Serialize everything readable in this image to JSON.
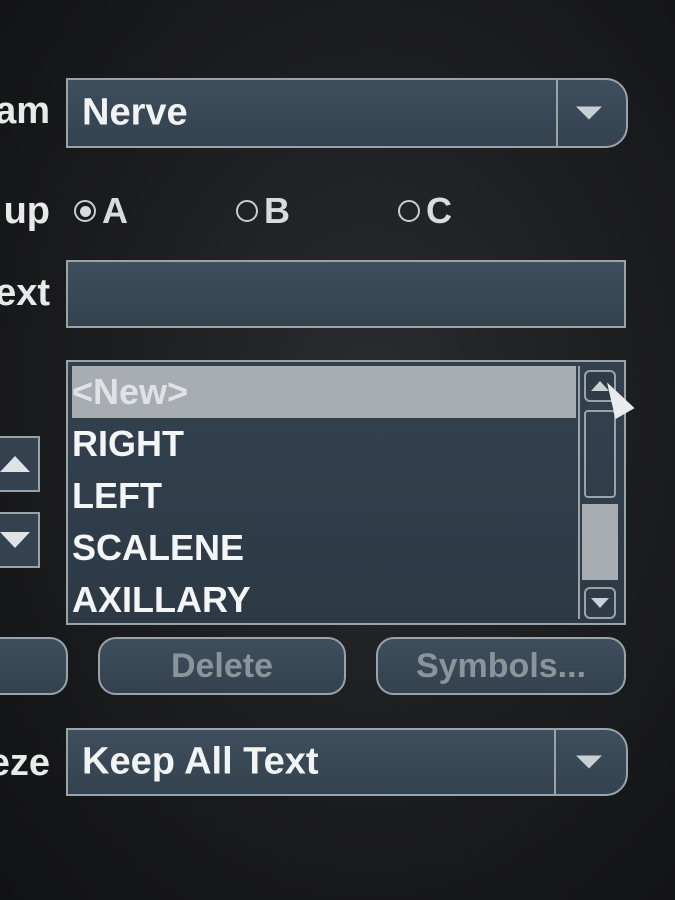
{
  "labels": {
    "program": "am",
    "group": "up",
    "text": "ext",
    "freeze": "eze"
  },
  "program_combo": {
    "value": "Nerve",
    "arrow_icon": "chevron-down-icon"
  },
  "group_radios": [
    {
      "label": "A",
      "selected": true
    },
    {
      "label": "B",
      "selected": false
    },
    {
      "label": "C",
      "selected": false
    }
  ],
  "text_field": {
    "value": ""
  },
  "list": {
    "items": [
      "<New>",
      "RIGHT",
      "LEFT",
      "SCALENE",
      "AXILLARY"
    ],
    "selected_index": 0
  },
  "buttons": {
    "delete_label": "Delete",
    "symbols_label": "Symbols..."
  },
  "freeze_combo": {
    "value": "Keep All Text",
    "arrow_icon": "chevron-down-icon"
  },
  "colors": {
    "field_bg": "#3a4a58",
    "border": "#9aa3a8",
    "selected_bg": "#a7adb1",
    "disabled_text": "#8b9499"
  }
}
